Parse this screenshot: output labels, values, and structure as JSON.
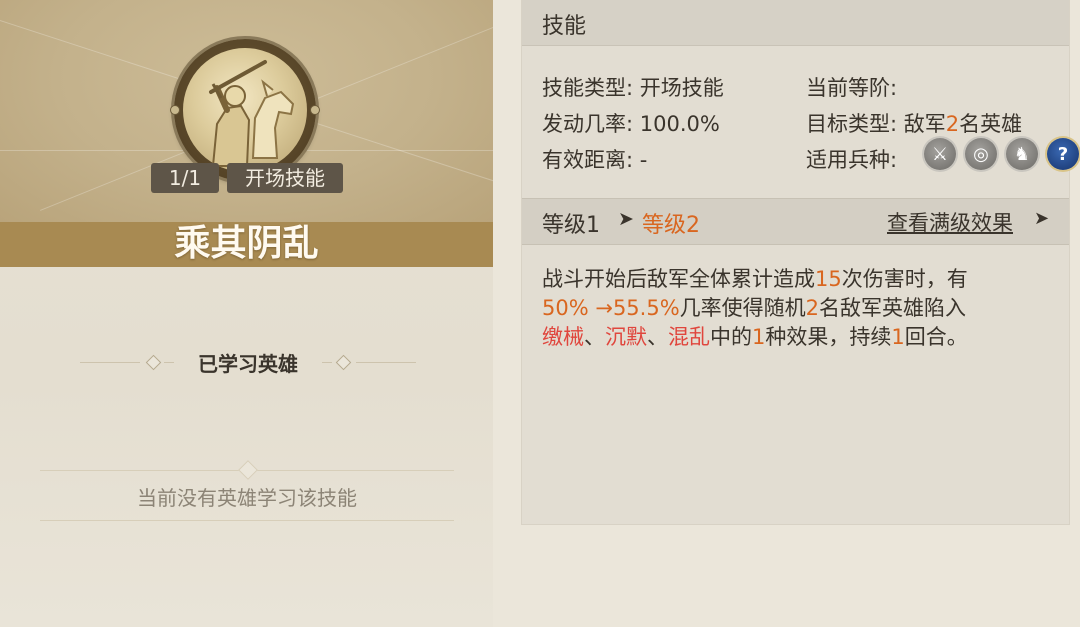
{
  "skill": {
    "name": "乘其阴乱",
    "count": "1/1",
    "type_tag": "开场技能"
  },
  "learned": {
    "heading": "已学习英雄",
    "empty_text": "当前没有英雄学习该技能"
  },
  "panel": {
    "title": "技能",
    "info": {
      "type_label": "技能类型:",
      "type_value": "开场技能",
      "rank_label": "当前等阶:",
      "rank_value": "",
      "rate_label": "发动几率:",
      "rate_value": "100.0%",
      "target_label": "目标类型:",
      "target_pre": "敌军",
      "target_num": "2",
      "target_post": "名英雄",
      "range_label": "有效距离:",
      "range_value": "-",
      "troop_label": "适用兵种:"
    },
    "troops": [
      {
        "name": "sword-icon",
        "glyph": "⚔"
      },
      {
        "name": "target-icon",
        "glyph": "◎"
      },
      {
        "name": "horse-icon",
        "glyph": "♞"
      },
      {
        "name": "question-icon",
        "glyph": "?"
      }
    ],
    "level": {
      "from": "等级1",
      "arrow": "➤",
      "to": "等级2",
      "view_full": "查看满级效果",
      "view_arrow": "➤"
    },
    "description": {
      "line1_a": "战斗开始后敌军全体累计造成",
      "line1_num": "15",
      "line1_b": "次伤害时，有",
      "line2_rate": "50% →55.5%",
      "line2_a": "几率使得随机",
      "line2_num": "2",
      "line2_b": "名敌军英雄陷入",
      "line3_e1": "缴械",
      "line3_sep1": "、",
      "line3_e2": "沉默",
      "line3_sep2": "、",
      "line3_e3": "混乱",
      "line3_a": "中的",
      "line3_num1": "1",
      "line3_b": "种效果，持续",
      "line3_num2": "1",
      "line3_c": "回合。"
    }
  },
  "colors": {
    "highlight_orange": "#d9661f",
    "highlight_red": "#e0463d",
    "title_band": "#a88a52"
  }
}
